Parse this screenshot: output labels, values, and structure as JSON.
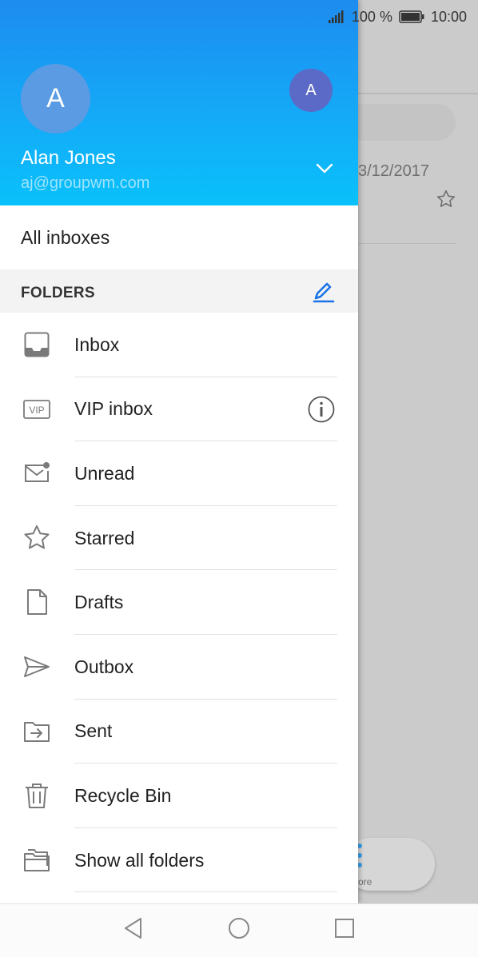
{
  "background": {
    "date": "3/12/2017",
    "fab_label": "ore"
  },
  "status_bar": {
    "battery": "100 %",
    "time": "10:00"
  },
  "account": {
    "initial": "A",
    "secondary_initial": "A",
    "name": "Alan Jones",
    "email": "aj@groupwm.com"
  },
  "drawer": {
    "all_inboxes": "All inboxes",
    "folders_title": "FOLDERS",
    "folders": [
      {
        "label": "Inbox",
        "icon": "inbox-icon"
      },
      {
        "label": "VIP inbox",
        "icon": "vip-icon"
      },
      {
        "label": "Unread",
        "icon": "unread-mail-icon"
      },
      {
        "label": "Starred",
        "icon": "star-icon"
      },
      {
        "label": "Drafts",
        "icon": "draft-icon"
      },
      {
        "label": "Outbox",
        "icon": "send-icon"
      },
      {
        "label": "Sent",
        "icon": "sent-folder-icon"
      },
      {
        "label": "Recycle Bin",
        "icon": "trash-icon"
      },
      {
        "label": "Show all folders",
        "icon": "folders-icon"
      }
    ]
  },
  "colors": {
    "header_top": "#1d8cf0",
    "header_bottom": "#09c1fb",
    "accent": "#1a73e8",
    "icon_grey": "#7a7a7a"
  }
}
